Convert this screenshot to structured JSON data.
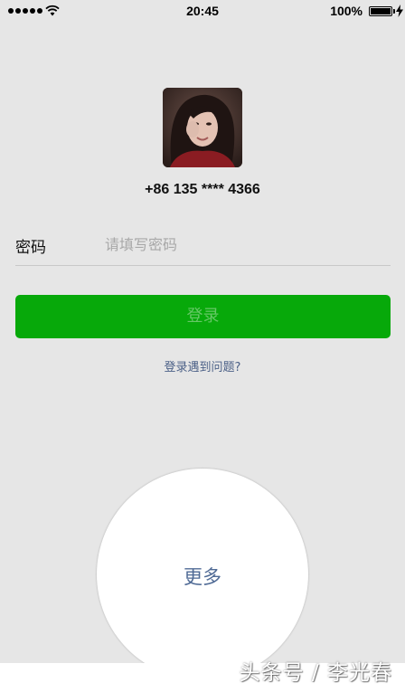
{
  "status_bar": {
    "time": "20:45",
    "battery_percent": "100%",
    "signal_bars": 5,
    "wifi_icon": "wifi-icon",
    "battery_icon": "battery-full-icon",
    "charging_icon": "lightning-icon"
  },
  "account": {
    "avatar_icon": "user-avatar-photo",
    "phone": "+86 135 **** 4366"
  },
  "form": {
    "password_label": "密码",
    "password_placeholder": "请填写密码",
    "password_value": ""
  },
  "actions": {
    "login_label": "登录",
    "help_link": "登录遇到问题?",
    "more_label": "更多"
  },
  "watermark": "头条号 / 李光春",
  "colors": {
    "background": "#e6e6e6",
    "accent_green": "#07a90a",
    "link_blue": "#4a5f86"
  }
}
